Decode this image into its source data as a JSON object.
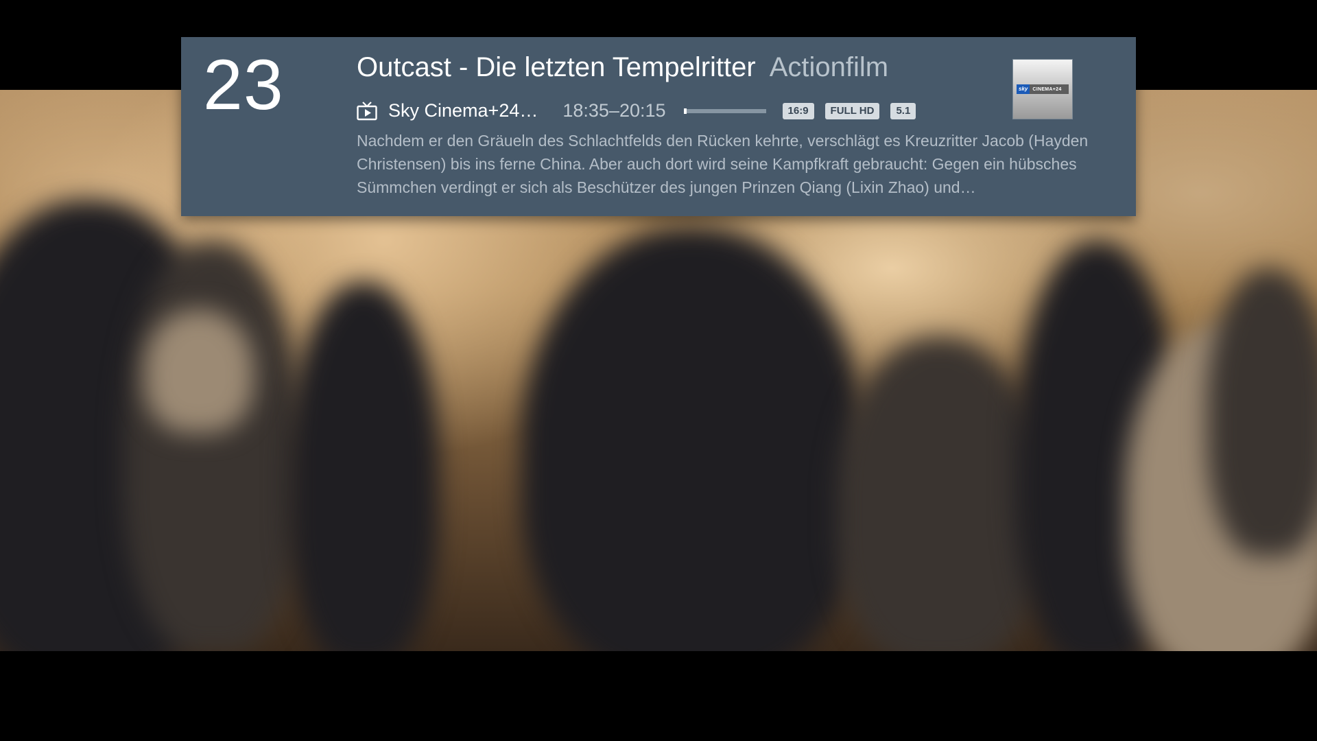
{
  "banner": {
    "channel_number": "23",
    "program_title": "Outcast - Die letzten Tempelritter",
    "program_genre": "Actionfilm",
    "channel_name": "Sky Cinema+24…",
    "time_range": "18:35–20:15",
    "progress": 0.04,
    "badges": [
      "16:9",
      "FULL HD",
      "5.1"
    ],
    "description": "Nachdem er den Gräueln des Schlachtfelds den Rücken kehrte, verschlägt es Kreuzritter Jacob (Hayden Christensen) bis ins ferne China. Aber auch dort wird seine Kampfkraft gebraucht: Gegen ein hübsches Sümmchen verdingt er sich als Beschützer des jungen Prinzen Qiang (Lixin Zhao) und…",
    "channel_logo": {
      "brand": "sky",
      "name": "CINEMA+24"
    },
    "icons": {
      "channel_type": "tv-play-icon"
    }
  }
}
